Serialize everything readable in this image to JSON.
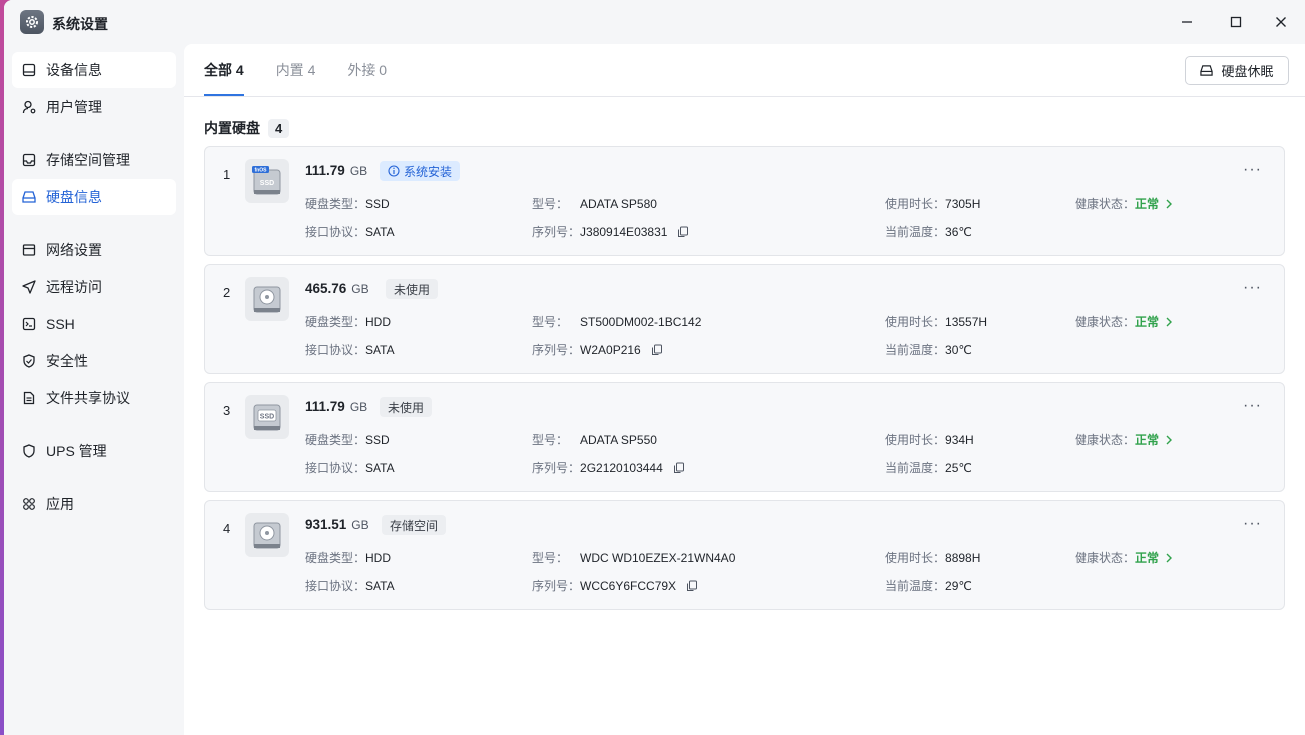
{
  "window": {
    "title": "系统设置"
  },
  "sidebar": {
    "items": [
      {
        "label": "设备信息"
      },
      {
        "label": "用户管理"
      },
      {
        "label": "存储空间管理"
      },
      {
        "label": "硬盘信息"
      },
      {
        "label": "网络设置"
      },
      {
        "label": "远程访问"
      },
      {
        "label": "SSH"
      },
      {
        "label": "安全性"
      },
      {
        "label": "文件共享协议"
      },
      {
        "label": "UPS 管理"
      },
      {
        "label": "应用"
      }
    ],
    "active": "硬盘信息"
  },
  "tabs": [
    {
      "label": "全部 4"
    },
    {
      "label": "内置 4"
    },
    {
      "label": "外接 0"
    }
  ],
  "toolbar": {
    "sleep_label": "硬盘休眠"
  },
  "section": {
    "title": "内置硬盘",
    "count": "4"
  },
  "labels": {
    "type": "硬盘类型：",
    "interface": "接口协议：",
    "model": "型号：",
    "serial": "序列号：",
    "hours": "使用时长：",
    "temp": "当前温度：",
    "health": "健康状态：",
    "more": "···"
  },
  "disks": [
    {
      "index": "1",
      "size": "111.79",
      "unit": "GB",
      "tag": "系统安装",
      "type": "SSD",
      "interface": "SATA",
      "model": "ADATA SP580",
      "serial": "J380914E03831",
      "hours": "7305H",
      "temp": "36℃",
      "health": "正常",
      "icon_badge": "fnOS",
      "icon_text": "SSD"
    },
    {
      "index": "2",
      "size": "465.76",
      "unit": "GB",
      "tag": "未使用",
      "type": "HDD",
      "interface": "SATA",
      "model": "ST500DM002-1BC142",
      "serial": "W2A0P216",
      "hours": "13557H",
      "temp": "30℃",
      "health": "正常"
    },
    {
      "index": "3",
      "size": "111.79",
      "unit": "GB",
      "tag": "未使用",
      "type": "SSD",
      "interface": "SATA",
      "model": "ADATA SP550",
      "serial": "2G2120103444",
      "hours": "934H",
      "temp": "25℃",
      "health": "正常",
      "icon_text": "SSD"
    },
    {
      "index": "4",
      "size": "931.51",
      "unit": "GB",
      "tag": "存储空间",
      "type": "HDD",
      "interface": "SATA",
      "model": "WDC WD10EZEX-21WN4A0",
      "serial": "WCC6Y6FCC79X",
      "hours": "8898H",
      "temp": "29℃",
      "health": "正常"
    }
  ],
  "colors": {
    "accent": "#2463d6",
    "healthy": "#31a24c",
    "tab_underline": "#2f74e0"
  }
}
